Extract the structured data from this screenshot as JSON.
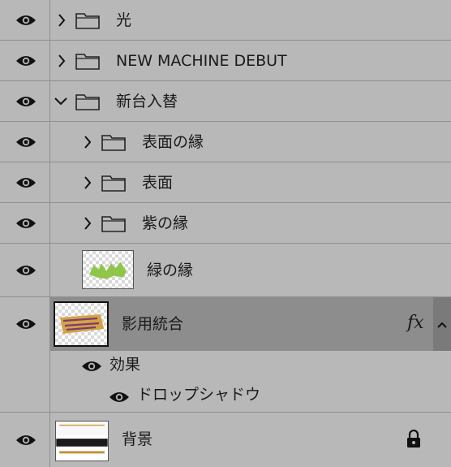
{
  "layers": [
    {
      "name": "光"
    },
    {
      "name": "NEW MACHINE DEBUT"
    },
    {
      "name": "新台入替"
    },
    {
      "name": "表面の縁"
    },
    {
      "name": "表面"
    },
    {
      "name": "紫の縁"
    },
    {
      "name": "緑の縁"
    },
    {
      "name": "影用統合"
    },
    {
      "name": "背景"
    }
  ],
  "effects": {
    "label": "効果",
    "items": [
      {
        "name": "ドロップシャドウ"
      }
    ]
  },
  "fx_badge": "fx",
  "icons": {
    "visibility": "eye-icon",
    "expand": "chevron-right-icon",
    "collapse": "chevron-down-icon",
    "group": "folder-icon",
    "lock": "lock-icon",
    "scroll": "chevron-up-icon"
  }
}
